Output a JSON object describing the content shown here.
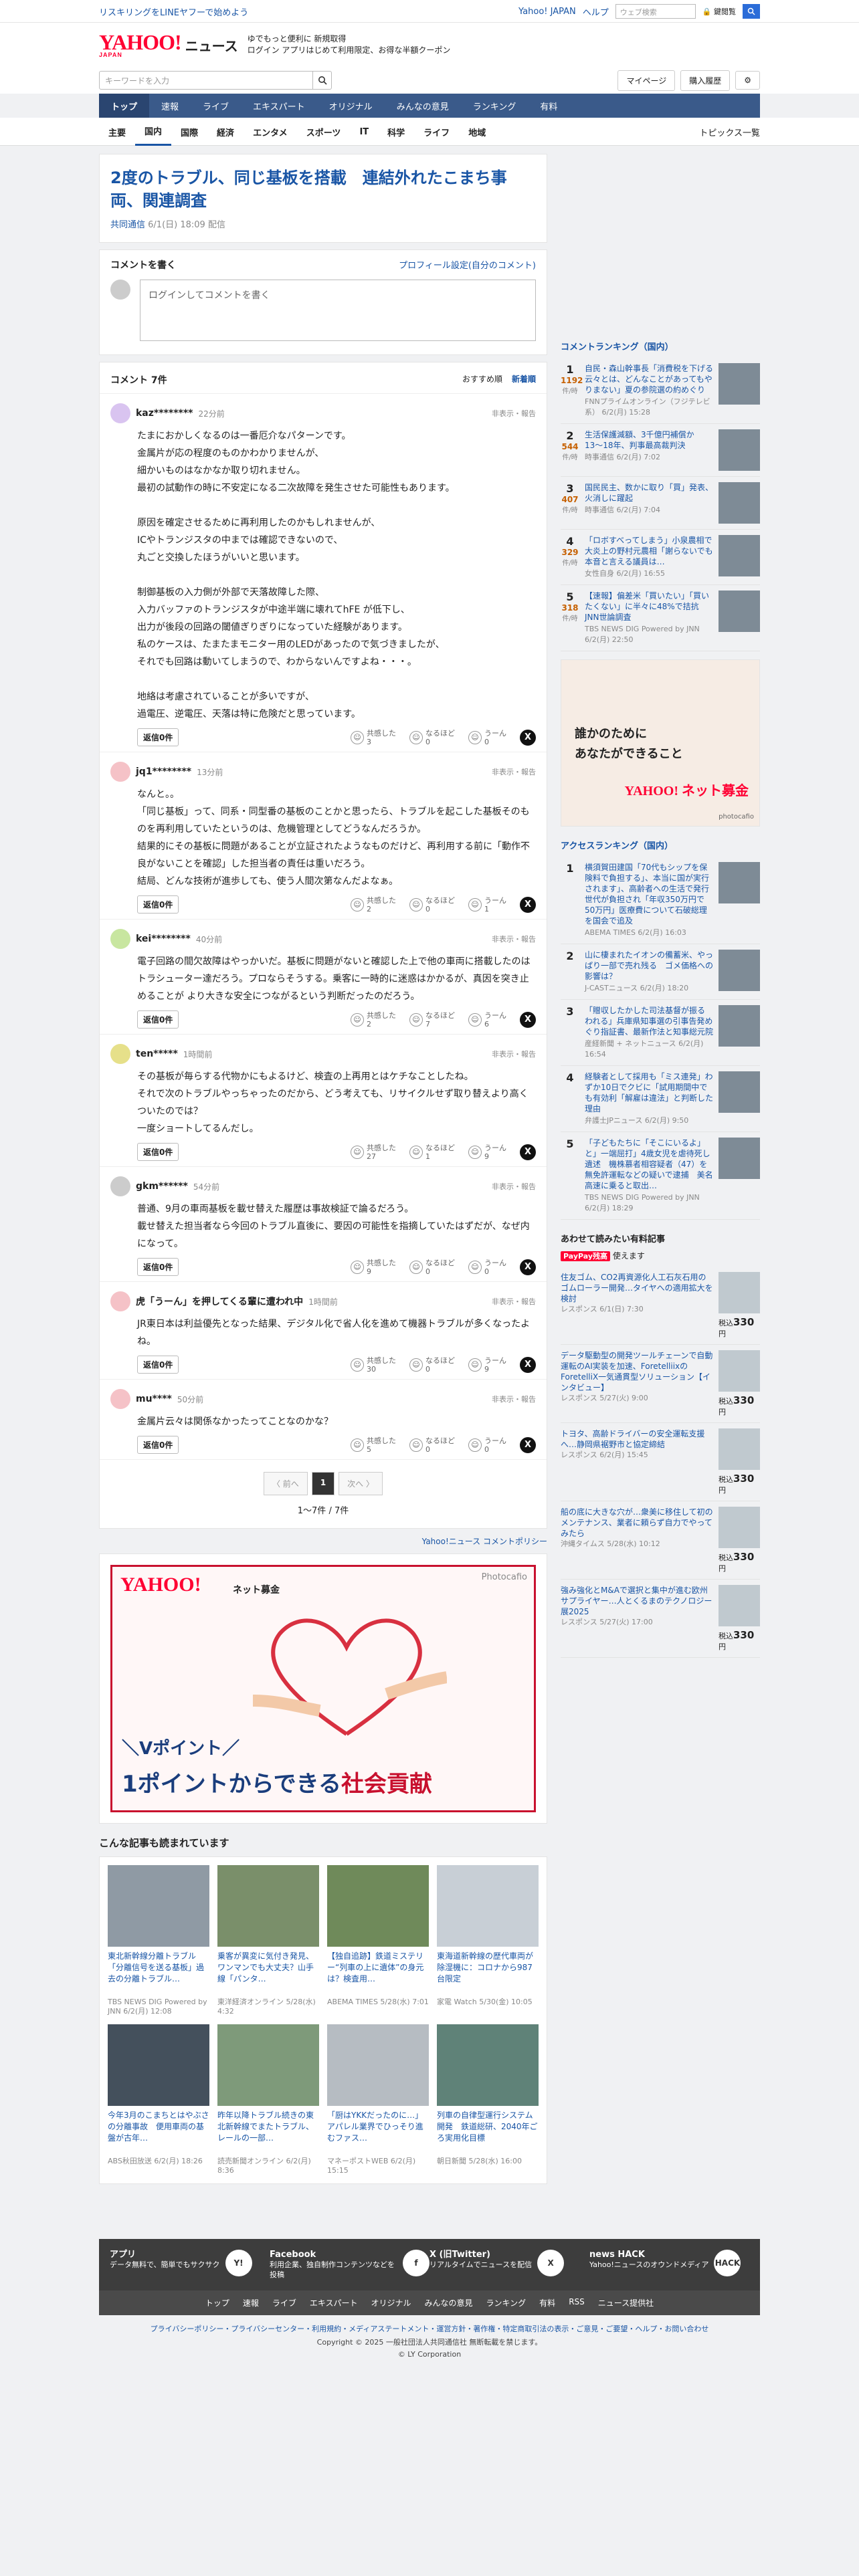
{
  "top_strip": {
    "promo": "リスキリングをLINEヤフーで始めよう",
    "links": [
      "Yahoo! JAPAN",
      "ヘルプ"
    ],
    "search_placeholder": "ウェブ検索",
    "unlock": "🔒 鍵閲覧"
  },
  "header": {
    "logo": "YAHOO!",
    "logo_sub": "JAPAN",
    "service": "ニュース",
    "promo_line1": "ゆでもっと便利に 新規取得",
    "promo_line2": "ログイン  アプリはじめて利用限定、お得な半額クーポン"
  },
  "search": {
    "placeholder": "キーワードを入力",
    "mypage": "マイページ",
    "subscribe": "購入履歴"
  },
  "nav": [
    "トップ",
    "速報",
    "ライブ",
    "エキスパート",
    "オリジナル",
    "みんなの意見",
    "ランキング",
    "有料"
  ],
  "subnav": [
    "主要",
    "国内",
    "国際",
    "経済",
    "エンタメ",
    "スポーツ",
    "IT",
    "科学",
    "ライフ",
    "地域"
  ],
  "subnav_right": "トピックス一覧",
  "article": {
    "title": "2度のトラブル、同じ基板を搭載　連結外れたこまち事両、関連調査",
    "source": "共同通信",
    "date": "6/1(日) 18:09 配信"
  },
  "comment_form": {
    "title": "コメントを書く",
    "settings": "プロフィール設定(自分のコメント)",
    "prompt": "ログインしてコメントを書く"
  },
  "comment_list": {
    "title": "コメント 7件",
    "sort": [
      "おすすめ順",
      "新着順"
    ],
    "reply_label": "返信0件",
    "react_labels": [
      "共感した",
      "なるほど",
      "うーん"
    ],
    "report": "非表示・報告",
    "items": [
      {
        "user": "kaz********",
        "time": "22分前",
        "color": "#d9c4f0",
        "body": "たまにおかしくなるのは一番厄介なパターンです。\n金属片が応の程度のものかわかりませんが、\n細かいものはなかなか取り切れません。\n最初の試動作の時に不安定になる二次故障を発生させた可能性もあります。\n\n原因を確定させるために再利用したのかもしれませんが、\nICやトランジスタの中までは確認できないので、\n丸ごと交換したほうがいいと思います。\n\n制御基板の入力側が外部で天落故障した際、\n入力バッファのトランジスタが中途半端に壊れてhFE が低下し、\n出力が後段の回路の閾値ぎりぎりになっていた経験があります。\n私のケースは、たまたまモニター用のLEDがあったので気づきましたが、\nそれでも回路は動いてしまうので、わからないんですよね・・・。\n\n地絡は考慮されていることが多いですが、\n過電圧、逆電圧、天落は特に危険だと思っています。",
        "r": [
          3,
          0,
          0
        ]
      },
      {
        "user": "jq1********",
        "time": "13分前",
        "color": "#f5c2c7",
        "body": "なんと。。\n「同じ基板」って、同系・同型番の基板のことかと思ったら、トラブルを起こした基板そのものを再利用していたというのは、危機管理としてどうなんだろうか。\n結果的にその基板に問題があることが立証されたようなものだけど、再利用する前に「動作不良がないことを確認」した担当者の責任は重いだろう。\n結局、どんな技術が進歩しても、使う人間次第なんだよなぁ。",
        "r": [
          2,
          0,
          1
        ]
      },
      {
        "user": "kei********",
        "time": "40分前",
        "color": "#c8e6a0",
        "body": "電子回路の間欠故障はやっかいだ。基板に問題がないと確認した上で他の車両に搭載したのはトラシューター達だろう。プロならそうする。乗客に一時的に迷惑はかかるが、真因を突き止めることが より大きな安全につながるという判断だったのだろう。",
        "r": [
          2,
          7,
          6
        ]
      },
      {
        "user": "ten*****",
        "time": "1時間前",
        "color": "#e6e08a",
        "body": "その基板が毎らする代物かにもよるけど、検査の上再用とはケチなことしたね。\nそれで次のトラブルやっちゃったのだから、どう考えても、リサイクルせず取り替えより高くついたのでは？\n一度ショートしてるんだし。",
        "r": [
          27,
          1,
          9
        ]
      },
      {
        "user": "gkm******",
        "time": "54分前",
        "color": "#cccccc",
        "body": "普通、9月の車両基板を載せ替えた履歴は事故検証で論るだろう。\n載せ替えた担当者なら今回のトラブル直後に、要因の可能性を指摘していたはずだが、なぜ内になって。",
        "r": [
          9,
          0,
          0
        ]
      },
      {
        "user": "虎「うーん」を押してくる輩に遭われ中",
        "time": "1時間前",
        "color": "#f5c2c7",
        "body": "JR東日本は利益優先となった結果、デジタル化で省人化を進めて機器トラブルが多くなったよね。",
        "r": [
          30,
          0,
          9
        ]
      },
      {
        "user": "mu****",
        "time": "50分前",
        "color": "#f5c2c7",
        "body": "金属片云々は関係なかったってことなのかな？",
        "r": [
          5,
          0,
          0
        ]
      }
    ]
  },
  "pager": {
    "prev": "〈 前へ",
    "page": "1",
    "next": "次へ 〉",
    "info": "1〜7件 / 7件"
  },
  "policy": "Yahoo!ニュース コメントポリシー",
  "banner": {
    "logo": "YAHOO!",
    "sub": "ネット募金",
    "photo": "Photocafio",
    "line1": "＼Vポイント／",
    "line2a": "1ポイントからできる",
    "line2b": "社会貢献"
  },
  "related": {
    "title": "こんな記事も読まれています",
    "items": [
      {
        "t": "東北新幹線分離トラブル「分離信号を送る基板」過去の分離トラブル…",
        "s": "TBS NEWS DIG Powered by JNN  6/2(月) 12:08"
      },
      {
        "t": "乗客が異変に気付き発見、ワンマンでも大丈夫？山手線「パンタ…",
        "s": "東洋経済オンライン  5/28(水) 4:32"
      },
      {
        "t": "【独自追跡】鉄道ミステリー“列車の上に遺体”の身元は？検査用…",
        "s": "ABEMA TIMES  5/28(水) 7:01"
      },
      {
        "t": "東海道新幹線の歴代車両が除湿機に：コロナから987台限定",
        "s": "家電 Watch  5/30(金) 10:05"
      },
      {
        "t": "今年3月のこまちとはやぶさの分離事故　便用車両の基盤が古年…",
        "s": "ABS秋田放送  6/2(月) 18:26"
      },
      {
        "t": "昨年以降トラブル続きの東北新幹線でまたトラブル、レールの一部…",
        "s": "読売新聞オンライン  6/2(月) 8:36"
      },
      {
        "t": "「厨はYKKだったのに…」アパレル業界でひっそり進むファス…",
        "s": "マネーポストWEB  6/2(月) 15:15"
      },
      {
        "t": "列車の自律型運行システム開発　鉄道総研、2040年ごろ実用化目標",
        "s": "朝日新聞  5/28(水) 16:00"
      }
    ]
  },
  "side": {
    "rank_title": "コメントランキング（国内）",
    "rank_unit": "件/時",
    "ranks": [
      {
        "n": "1",
        "c": "1192",
        "t": "自民・森山幹事長「消費税を下げる云々とは、どんなことがあってもやりまない」夏の参院選の約めぐり",
        "s": "FNNプライムオンライン（フジテレビ系）  6/2(月) 15:28"
      },
      {
        "n": "2",
        "c": "544",
        "t": "生活保護減額、3千億円補償か　13〜18年、判事最高裁判決",
        "s": "時事通信  6/2(月) 7:02"
      },
      {
        "n": "3",
        "c": "407",
        "t": "国民民主、数かに取り「買」発表、火消しに躍起",
        "s": "時事通信  6/2(月) 7:04"
      },
      {
        "n": "4",
        "c": "329",
        "t": "「ロボすべってしまう」小泉農相で大炎上の野村元農相「謝らないでも本音と言える議員は…",
        "s": "女性自身  6/2(月) 16:55"
      },
      {
        "n": "5",
        "c": "318",
        "t": "【速報】偏差米「買いたい」「買いたくない」に半々に48%で拮抗　JNN世論調査",
        "s": "TBS NEWS DIG Powered by JNN  6/2(月) 22:50"
      }
    ],
    "ad_line1": "誰かのために",
    "ad_line2": "あなたができること",
    "ad_logo": "YAHOO! ネット募金",
    "ad_photo": "photocafio",
    "access_title": "アクセスランキング（国内）",
    "access": [
      {
        "n": "1",
        "t": "横須賀田建国「70代もシップを保険料で負担する」、本当に国が実行されます」、高齢者への生活で発行世代が負担され「年収350万円で50万円」医療費について石破総理を国会で追及",
        "s": "ABEMA TIMES  6/2(月) 16:03"
      },
      {
        "n": "2",
        "t": "山に棲まれたイオンの備蓄米、やっぱり一部で売れ残る　ゴメ価格への影響は？",
        "s": "J-CASTニュース  6/2(月) 18:20"
      },
      {
        "n": "3",
        "t": "「贈収したかした司法基督が振るわれる」兵庫県知事選の引事告発めぐり指証書、最新作法と知事総元院",
        "s": "産経新聞 + ネットニュース  6/2(月) 16:54"
      },
      {
        "n": "4",
        "t": "経験者として採用も「ミス連発」わずか10日でクビに「試用期間中でも有効利「解雇は違法」と判断した理由",
        "s": "弁護士JPニュース  6/2(月) 9:50"
      },
      {
        "n": "5",
        "t": "「子どもたちに「そこにいるよ」と」一端屈打」4歳女児を虐待死し遺述　機株慕者相容疑者（47）を無免許運転などの疑いで逮捕　美名高速に乗ると取出…",
        "s": "TBS NEWS DIG Powered by JNN  6/2(月) 18:29"
      }
    ],
    "shop_title": "あわせて読みたい有料記事",
    "shop_badge": "PayPay残高",
    "shop_badge_tail": "使えます",
    "shop_price": "330",
    "shop_price_prefix": "税込",
    "shop_price_suffix": "円",
    "shop": [
      {
        "t": "住友ゴム、CO2再資源化人工石灰石用のゴムローラー開発…タイヤへの適用拡大を検討",
        "s": "レスポンス  6/1(日) 7:30"
      },
      {
        "t": "データ駆動型の開発ツールチェーンで自動運転のAI実装を加速、ForetelliixのForetelliX一気通貫型ソリューション【インタビュー】",
        "s": "レスポンス  5/27(火) 9:00"
      },
      {
        "t": "トヨタ、高齢ドライバーの安全運転支援へ…静岡県裾野市と協定締結",
        "s": "レスポンス  6/2(月) 15:45"
      },
      {
        "t": "船の底に大きな穴が…衆美に移住して初のメンテナンス、業者に頼らず自力でやってみたら",
        "s": "沖縄タイムス  5/28(水) 10:12"
      },
      {
        "t": "強み強化とM&Aで選択と集中が進む欧州サプライヤー…人とくるまのテクノロジー展2025",
        "s": "レスポンス  5/27(火) 17:00"
      }
    ]
  },
  "footer": {
    "cols": [
      {
        "title": "アプリ",
        "desc": "データ無料で、簡単でもサクサク",
        "icon": "Y!"
      },
      {
        "title": "Facebook",
        "desc": "利用企業、独自制作コンテンツなどを投稿",
        "icon": "f"
      },
      {
        "title": "X (旧Twitter)",
        "desc": "リアルタイムでニュースを配信",
        "icon": "X"
      },
      {
        "title": "news HACK",
        "desc": "Yahoo!ニュースのオウンドメディア",
        "icon": "HACK"
      }
    ],
    "nav": [
      "トップ",
      "速報",
      "ライブ",
      "エキスパート",
      "オリジナル",
      "みんなの意見",
      "ランキング",
      "有料",
      "RSS",
      "ニュース提供社"
    ],
    "links": "プライバシーポリシー・プライバシーセンター・利用規約・メディアステートメント・運営方針・著作権・特定商取引法の表示・ご意見・ご要望・ヘルプ・お問い合わせ",
    "copy1": "Copyright © 2025 一般社団法人共同通信社 無断転載を禁じます。",
    "copy2": "© LY Corporation"
  }
}
